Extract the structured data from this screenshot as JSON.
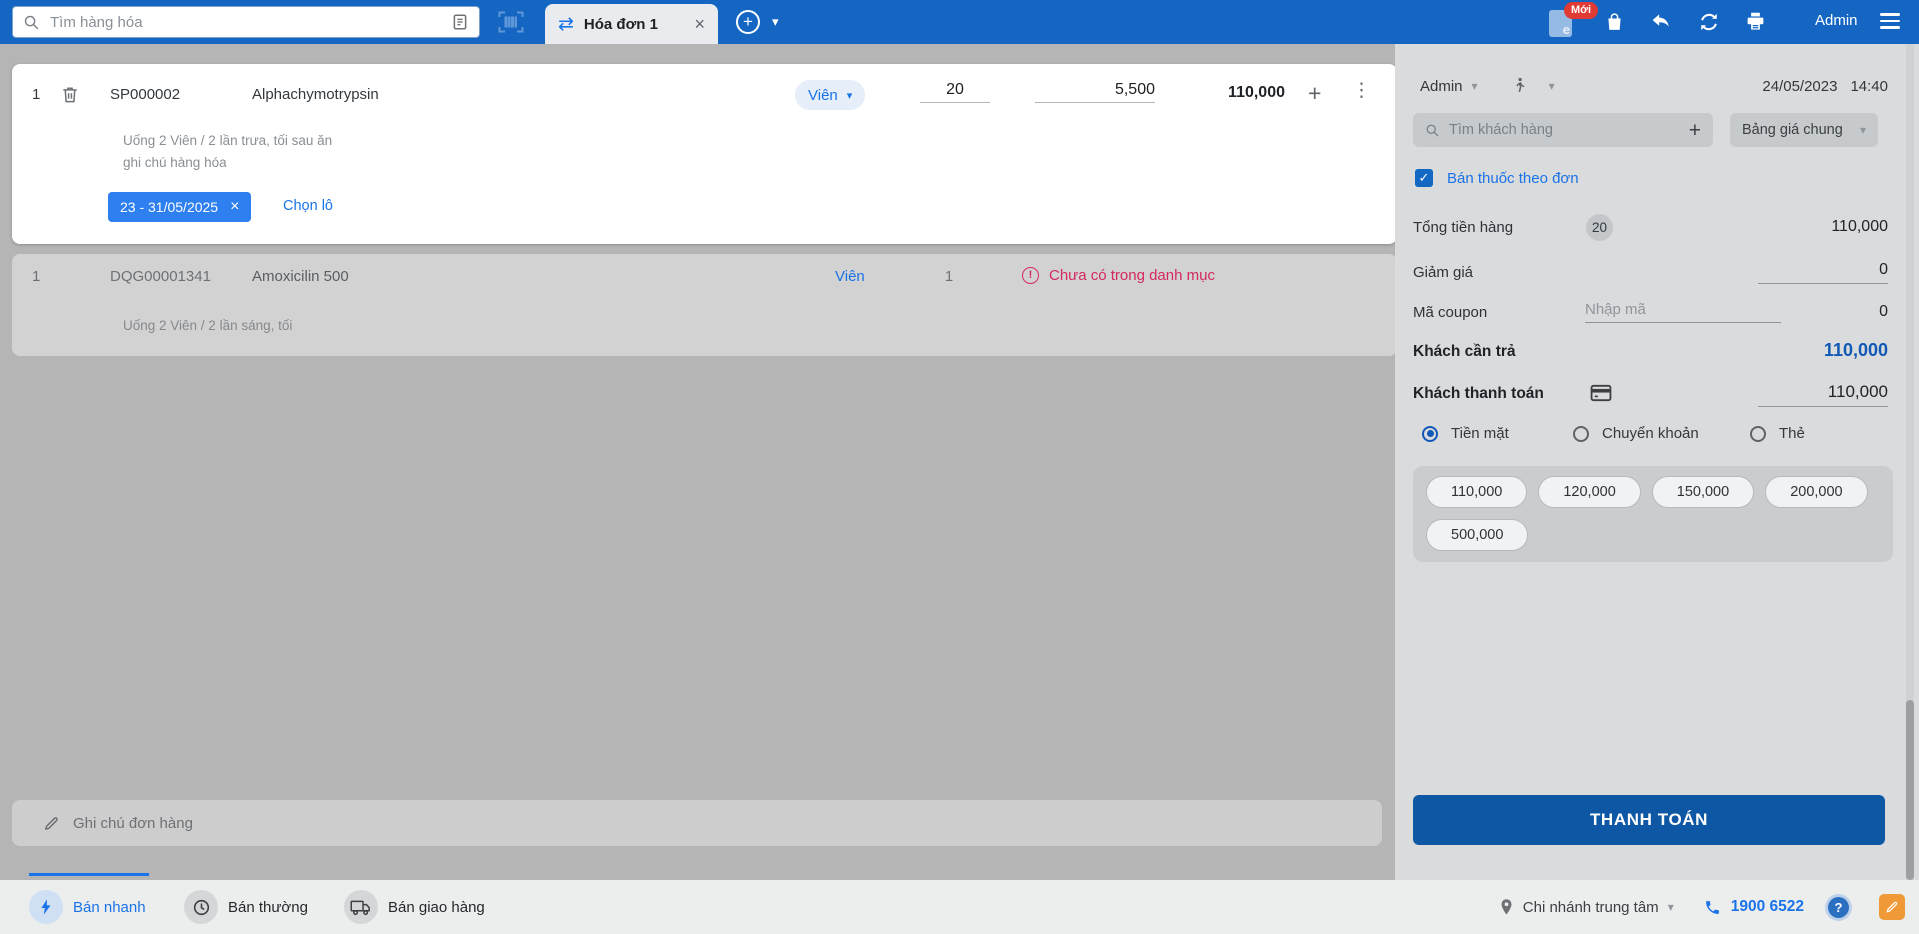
{
  "colors": {
    "topbar_blue": "#1466c2",
    "link_blue": "#1a73e8",
    "batch_chip_blue": "#2e7ff0",
    "pay_button_blue": "#0e57a5",
    "warning_pink": "#d4295e",
    "new_badge_red": "#e03a34"
  },
  "topbar": {
    "product_search_placeholder": "Tìm hàng hóa",
    "tab_label": "Hóa đơn 1",
    "new_badge": "Mới",
    "user_label": "Admin"
  },
  "cart": {
    "rows": [
      {
        "index": "1",
        "code": "SP000002",
        "name": "Alphachymotrypsin",
        "unit": "Viên",
        "quantity": "20",
        "unit_price": "5,500",
        "line_total": "110,000",
        "usage_note": "Uống 2 Viên / 2 lần trưa, tối sau ăn",
        "item_note": "ghi chú hàng hóa",
        "batch_label": "23 - 31/05/2025",
        "choose_batch_label": "Chọn lô"
      },
      {
        "index": "1",
        "code": "DQG00001341",
        "name": "Amoxicilin 500",
        "unit": "Viên",
        "quantity": "1",
        "warning_label": "Chưa có trong danh mục",
        "usage_note": "Uống 2 Viên / 2 lần sáng, tối"
      }
    ],
    "order_note_placeholder": "Ghi chú đơn hàng"
  },
  "panel": {
    "seller": "Admin",
    "date": "24/05/2023",
    "time": "14:40",
    "customer_search_placeholder": "Tìm khách hàng",
    "price_list": "Bảng giá chung",
    "prescription_label": "Bán thuốc theo đơn",
    "subtotal_label": "Tổng tiền hàng",
    "subtotal_qty_badge": "20",
    "subtotal_value": "110,000",
    "discount_label": "Giảm giá",
    "discount_value": "0",
    "coupon_label": "Mã coupon",
    "coupon_placeholder": "Nhập mã",
    "coupon_value": "0",
    "due_label": "Khách cần trả",
    "due_value": "110,000",
    "paid_label": "Khách thanh toán",
    "paid_value": "110,000",
    "methods": [
      {
        "label": "Tiền mặt",
        "selected": true
      },
      {
        "label": "Chuyển khoản",
        "selected": false
      },
      {
        "label": "Thẻ",
        "selected": false
      }
    ],
    "denominations": [
      "110,000",
      "120,000",
      "150,000",
      "200,000",
      "500,000"
    ],
    "pay_button_label": "THANH TOÁN"
  },
  "bottombar": {
    "modes": [
      {
        "label": "Bán nhanh",
        "active": true
      },
      {
        "label": "Bán thường",
        "active": false
      },
      {
        "label": "Bán giao hàng",
        "active": false
      }
    ],
    "branch": "Chi nhánh trung tâm",
    "hotline": "1900 6522"
  }
}
